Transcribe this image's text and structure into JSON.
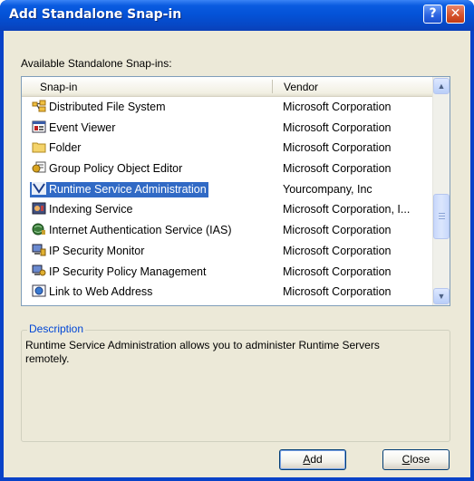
{
  "window": {
    "title": "Add Standalone Snap-in"
  },
  "titlebar_buttons": {
    "help": "?",
    "close": "✕"
  },
  "available_label": "Available Standalone Snap-ins:",
  "columns": {
    "snapin": "Snap-in",
    "vendor": "Vendor"
  },
  "rows": [
    {
      "name": "Distributed File System",
      "vendor": "Microsoft Corporation",
      "icon": "dfs-icon"
    },
    {
      "name": "Event Viewer",
      "vendor": "Microsoft Corporation",
      "icon": "event-viewer-icon"
    },
    {
      "name": "Folder",
      "vendor": "Microsoft Corporation",
      "icon": "folder-icon"
    },
    {
      "name": "Group Policy Object Editor",
      "vendor": "Microsoft Corporation",
      "icon": "group-policy-icon"
    },
    {
      "name": "Runtime Service Administration",
      "vendor": "Yourcompany, Inc",
      "icon": "runtime-service-icon",
      "selected": true
    },
    {
      "name": "Indexing Service",
      "vendor": "Microsoft Corporation, I...",
      "icon": "indexing-service-icon"
    },
    {
      "name": "Internet Authentication Service (IAS)",
      "vendor": "Microsoft Corporation",
      "icon": "ias-icon"
    },
    {
      "name": "IP Security Monitor",
      "vendor": "Microsoft Corporation",
      "icon": "ip-security-monitor-icon"
    },
    {
      "name": "IP Security Policy Management",
      "vendor": "Microsoft Corporation",
      "icon": "ip-security-policy-icon"
    },
    {
      "name": "Link to Web Address",
      "vendor": "Microsoft Corporation",
      "icon": "web-link-icon"
    }
  ],
  "description": {
    "legend": "Description",
    "text": "Runtime Service Administration allows you to administer Runtime Servers remotely."
  },
  "buttons": {
    "add_mnemonic": "A",
    "add_rest": "dd",
    "close_mnemonic": "C",
    "close_rest": "lose"
  },
  "colors": {
    "selection": "#316ac5",
    "title_bar": "#0453d8",
    "dialog_bg": "#ece9d8",
    "legend": "#0046d5"
  }
}
